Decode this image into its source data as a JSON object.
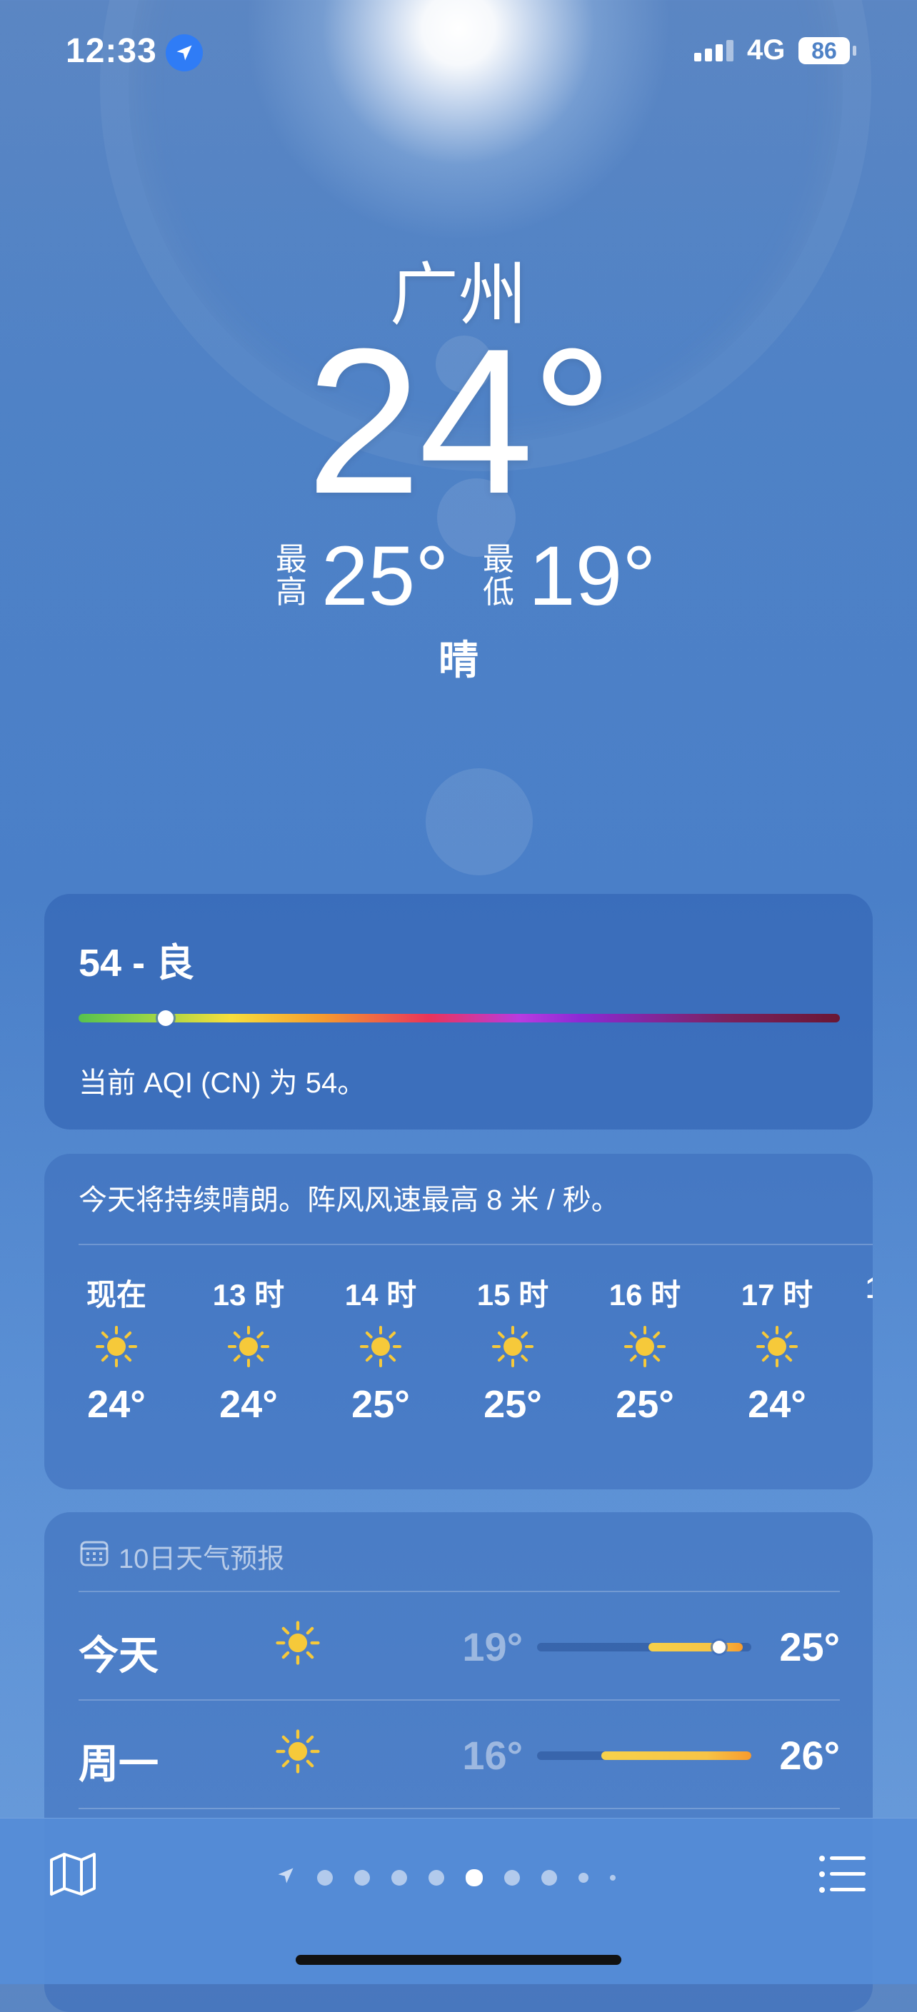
{
  "status_bar": {
    "time": "12:33",
    "network": "4G",
    "battery": "86"
  },
  "header": {
    "city": "广州",
    "temperature": "24°",
    "high_label": [
      "最",
      "高"
    ],
    "high_value": "25°",
    "low_label": [
      "最",
      "低"
    ],
    "low_value": "19°",
    "condition": "晴"
  },
  "aqi": {
    "title": "54 - 良",
    "value": 54,
    "description": "当前 AQI (CN) 为 54。"
  },
  "hourly": {
    "summary": "今天将持续晴朗。阵风风速最高 8 米 / 秒。",
    "items": [
      {
        "label": "现在",
        "icon": "sun-icon",
        "temp": "24°"
      },
      {
        "label": "13 时",
        "icon": "sun-icon",
        "temp": "24°"
      },
      {
        "label": "14 时",
        "icon": "sun-icon",
        "temp": "25°"
      },
      {
        "label": "15 时",
        "icon": "sun-icon",
        "temp": "25°"
      },
      {
        "label": "16 时",
        "icon": "sun-icon",
        "temp": "25°"
      },
      {
        "label": "17 时",
        "icon": "sun-icon",
        "temp": "24°"
      }
    ],
    "peek_label": "1"
  },
  "daily": {
    "title": "10日天气预报",
    "days": [
      {
        "name": "今天",
        "icon": "sun-icon",
        "low": "19°",
        "high": "25°",
        "range_start": 0.52,
        "range_end": 0.96,
        "current": 0.85
      },
      {
        "name": "周一",
        "icon": "sun-icon",
        "low": "16°",
        "high": "26°",
        "range_start": 0.3,
        "range_end": 1.0
      }
    ]
  },
  "toolbar": {
    "pages": 9,
    "active_page": 5
  },
  "colors": {
    "sun": "#f6c93a",
    "location_badge": "#2f7cf6"
  }
}
